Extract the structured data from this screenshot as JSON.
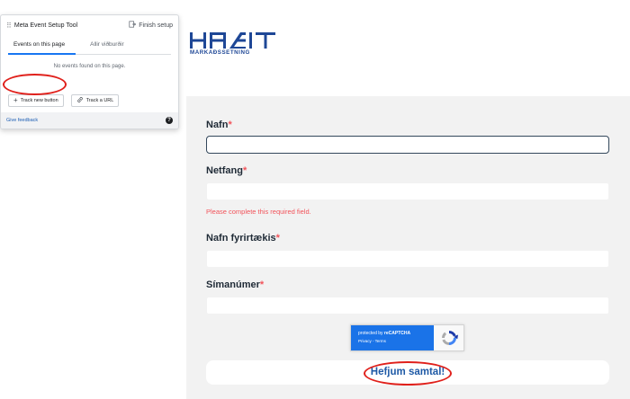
{
  "setup_tool": {
    "title": "Meta Event Setup Tool",
    "finish_label": "Finish setup",
    "tabs": [
      {
        "label": "Events on this page",
        "active": true
      },
      {
        "label": "Allir viðburðir",
        "active": false
      }
    ],
    "empty_message": "No events found on this page.",
    "track_button_label": "Track new button",
    "track_url_label": "Track a URL",
    "feedback_label": "Give feedback",
    "help_glyph": "?"
  },
  "logo": {
    "brand": "HAEIT",
    "tagline": "MARKAÐSSETNING",
    "color": "#1e4796"
  },
  "form": {
    "fields": [
      {
        "label": "Nafn",
        "required_mark": "*",
        "value": "",
        "focused": true
      },
      {
        "label": "Netfang",
        "required_mark": "*",
        "value": "",
        "focused": false
      },
      {
        "label": "Nafn fyrirtækis",
        "required_mark": "*",
        "value": "",
        "focused": false
      },
      {
        "label": "Símanúmer",
        "required_mark": "*",
        "value": "",
        "focused": false
      }
    ],
    "error_message": "Please complete this required field.",
    "recaptcha": {
      "line1_prefix": "protected by ",
      "line1_brand": "reCAPTCHA",
      "line2": "Privacy - Terms"
    },
    "submit_label": "Hefjum samtal!"
  },
  "colors": {
    "accent_blue": "#1877f2",
    "error_red": "#f2545b",
    "annotation_red": "#e0201b",
    "form_bg": "#f2f2f2"
  }
}
